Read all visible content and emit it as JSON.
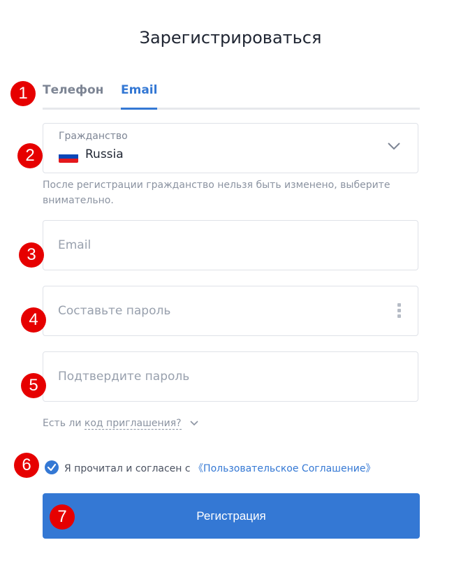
{
  "title": "Зарегистрироваться",
  "tabs": [
    {
      "label": "Телефон",
      "active": false
    },
    {
      "label": "Email",
      "active": true
    }
  ],
  "citizenship": {
    "label": "Гражданство",
    "value": "Russia",
    "flag": "russia-flag-icon"
  },
  "citizenship_hint": "После регистрации гражданство нельзя быть изменено, выберите внимательно.",
  "email": {
    "placeholder": "Email",
    "value": ""
  },
  "password": {
    "placeholder": "Составьте пароль",
    "value": ""
  },
  "confirm_password": {
    "placeholder": "Подтвердите пароль",
    "value": ""
  },
  "invite": {
    "prefix": "Есть ли ",
    "link": "код приглашения?"
  },
  "agreement": {
    "checked": true,
    "text": "Я прочитал и согласен с ",
    "link": "《Пользовательское Соглашение》"
  },
  "submit_label": "Регистрация",
  "colors": {
    "accent": "#3478d4",
    "badge": "#e60000"
  },
  "badges": [
    "1",
    "2",
    "3",
    "4",
    "5",
    "6",
    "7"
  ]
}
